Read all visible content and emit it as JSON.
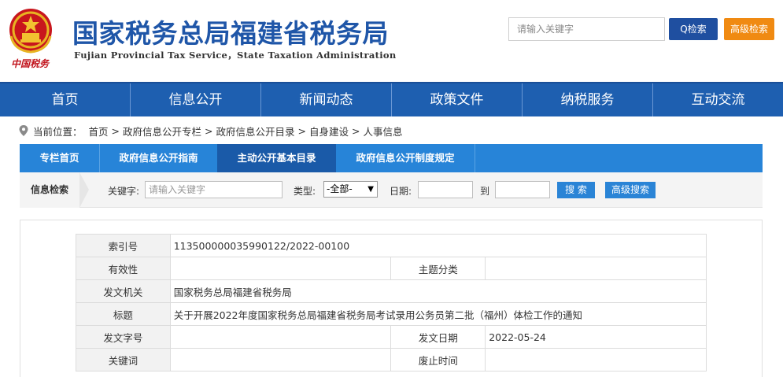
{
  "header": {
    "title_cn": "国家税务总局福建省税务局",
    "title_en": "Fujian Provincial Tax Service，State Taxation Administration",
    "brand_script": "中国税务",
    "search_placeholder": "请输入关键字",
    "search_button": "Q检索",
    "advanced_button": "高级检索"
  },
  "nav": {
    "items": [
      "首页",
      "信息公开",
      "新闻动态",
      "政策文件",
      "纳税服务",
      "互动交流"
    ]
  },
  "breadcrumb": {
    "prefix": "当前位置：",
    "items": [
      "首页",
      "政府信息公开专栏",
      "政府信息公开目录",
      "自身建设",
      "人事信息"
    ],
    "separator": ">"
  },
  "subnav": {
    "items": [
      "专栏首页",
      "政府信息公开指南",
      "主动公开基本目录",
      "政府信息公开制度规定"
    ],
    "active_index": 2
  },
  "filter": {
    "title": "信息检索",
    "keyword_label": "关键字:",
    "keyword_placeholder": "请输入关键字",
    "type_label": "类型:",
    "type_value": "-全部-",
    "date_label": "日期:",
    "to_label": "到",
    "search_button": "搜 索",
    "advanced_button": "高级搜索"
  },
  "meta": {
    "index_label": "索引号",
    "index_value": "113500000035990122/2022-00100",
    "validity_label": "有效性",
    "validity_value": "",
    "topic_label": "主题分类",
    "topic_value": "",
    "issuer_label": "发文机关",
    "issuer_value": "国家税务总局福建省税务局",
    "title_label": "标题",
    "title_value": "关于开展2022年度国家税务总局福建省税务局考试录用公务员第二批（福州）体检工作的通知",
    "docno_label": "发文字号",
    "docno_value": "",
    "date_label": "发文日期",
    "date_value": "2022-05-24",
    "keywords_label": "关键词",
    "keywords_value": "",
    "expiry_label": "废止时间",
    "expiry_value": ""
  },
  "colors": {
    "nav_blue": "#1e5fb0",
    "subnav_blue": "#2784d8",
    "title_blue": "#1f56a8",
    "accent_orange": "#f08a12",
    "emblem_red": "#c1121b"
  },
  "icons": [
    "national-emblem-icon",
    "search-icon",
    "location-pin-icon",
    "dropdown-caret-icon"
  ]
}
